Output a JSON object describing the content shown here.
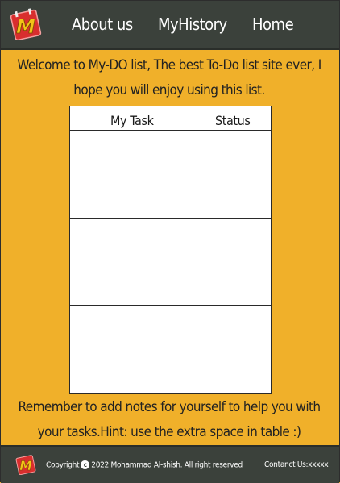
{
  "header": {
    "logo_letter": "M",
    "nav": [
      {
        "label": "About us"
      },
      {
        "label": "MyHistory"
      },
      {
        "label": "Home"
      }
    ]
  },
  "intro": {
    "line1": "Welcome to My-DO list, The best To-Do list site ever, I",
    "line2": "hope you will enjoy using this list."
  },
  "table": {
    "columns": [
      "My Task",
      "Status"
    ],
    "rows": [
      {
        "task": "",
        "status": ""
      },
      {
        "task": "",
        "status": ""
      },
      {
        "task": "",
        "status": ""
      }
    ]
  },
  "reminder": {
    "line1": "Remember to add notes for yourself  to help you with",
    "line2": "your tasks.Hint: use the extra space in table  :)"
  },
  "footer": {
    "logo_letter": "M",
    "copyright_prefix": "Copyright",
    "copyright_symbol": "c",
    "copyright_text": "2022 Mohammad Al-shish. All right reserved",
    "contact": "Contanct Us:xxxxx"
  },
  "colors": {
    "background": "#f0b02a",
    "bar": "#3b413b",
    "logo_red": "#d92e2e",
    "logo_yellow": "#f2c318"
  }
}
